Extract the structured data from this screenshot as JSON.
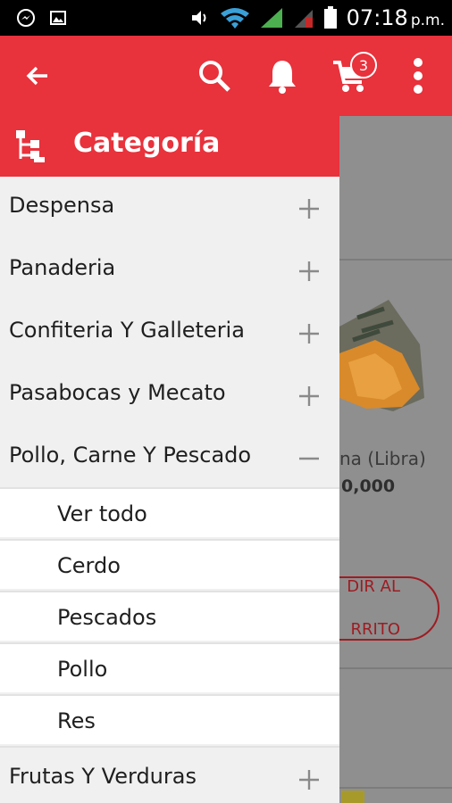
{
  "status_bar": {
    "time": "07:18",
    "ampm": "p.m.",
    "left_icons": [
      "messenger-icon",
      "gallery-icon"
    ],
    "right_icons": [
      "volume-icon",
      "wifi-icon",
      "signal-icon",
      "signal-roaming-icon",
      "battery-icon"
    ]
  },
  "app_bar": {
    "color": "#e8323c",
    "cart_count": "3",
    "icons": [
      "back-arrow-icon",
      "search-icon",
      "bell-icon",
      "cart-icon",
      "more-vertical-icon"
    ]
  },
  "drawer": {
    "title": "Categoría",
    "header_icon": "category-tree-icon",
    "categories": [
      {
        "label": "Despensa",
        "expanded": false
      },
      {
        "label": "Panaderia",
        "expanded": false
      },
      {
        "label": "Confiteria Y Galleteria",
        "expanded": false
      },
      {
        "label": "Pasabocas y Mecato",
        "expanded": false
      },
      {
        "label": "Pollo, Carne Y Pescado",
        "expanded": true
      },
      {
        "label": "Frutas Y Verduras",
        "expanded": false
      }
    ],
    "subcategories": [
      {
        "label": "Ver todo"
      },
      {
        "label": "Cerdo"
      },
      {
        "label": "Pescados"
      },
      {
        "label": "Pollo"
      },
      {
        "label": "Res"
      }
    ]
  },
  "background_product": {
    "name_partial": "na (Libra)",
    "price_partial": "0,000",
    "button_line1": "DIR AL",
    "button_line2": "RRITO"
  }
}
